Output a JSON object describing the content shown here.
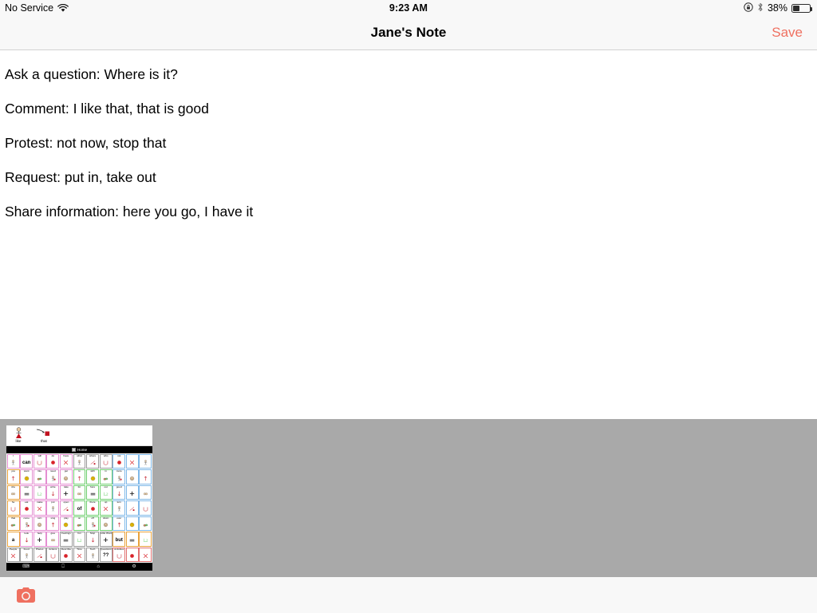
{
  "status_bar": {
    "carrier": "No Service",
    "wifi_icon": "wifi-icon",
    "time": "9:23 AM",
    "rotation_lock_icon": "rotation-lock-icon",
    "bluetooth_icon": "bluetooth-icon",
    "battery_percent": "38%",
    "battery_icon": "battery-icon"
  },
  "nav_bar": {
    "title": "Jane's Note",
    "save_label": "Save",
    "save_color": "#ef7060"
  },
  "note": {
    "lines": [
      "Ask a question: Where is it?",
      "Comment: I like that, that is good",
      "Protest: not now, stop that",
      "Request: put in, take out",
      "Share information: here you go, I have it"
    ]
  },
  "attachment": {
    "background_color": "#a9a9a9",
    "thumbnail": {
      "name": "aac-board-screenshot",
      "sentence_bar": [
        {
          "label": "like",
          "symbol": "person-with-heart"
        },
        {
          "label": "that",
          "symbol": "pointing-hand-at-square"
        }
      ],
      "home_bar_label": "Home",
      "grid_rows": [
        [
          {
            "label": "I",
            "big": "",
            "border": "#e58fd2"
          },
          {
            "label": "",
            "big": "can",
            "border": "#e58fd2"
          },
          {
            "label": "will",
            "big": "",
            "border": "#e58fd2"
          },
          {
            "label": "do",
            "big": "",
            "border": "#e58fd2"
          },
          {
            "label": "have",
            "big": "",
            "border": "#e58fd2"
          },
          {
            "label": "what",
            "big": "",
            "border": "#9a9a9a"
          },
          {
            "label": "where",
            "big": "",
            "border": "#9a9a9a"
          },
          {
            "label": "who",
            "big": "",
            "border": "#9a9a9a"
          },
          {
            "label": "not",
            "big": "",
            "border": "#7fb8e8"
          },
          {
            "label": "",
            "big": "",
            "border": "#7fb8e8"
          },
          {
            "label": "",
            "big": "",
            "border": "#7fb8e8"
          }
        ],
        [
          {
            "label": "you",
            "big": "",
            "border": "#e9a23b"
          },
          {
            "label": "want",
            "big": "",
            "border": "#e58fd2"
          },
          {
            "label": "like",
            "big": "",
            "border": "#e58fd2"
          },
          {
            "label": "need",
            "big": "",
            "border": "#e58fd2"
          },
          {
            "label": "get",
            "big": "",
            "border": "#e58fd2"
          },
          {
            "label": "to",
            "big": "",
            "border": "#6fcf6f"
          },
          {
            "label": "with",
            "big": "",
            "border": "#6fcf6f"
          },
          {
            "label": "in",
            "big": "",
            "border": "#6fcf6f"
          },
          {
            "label": "more",
            "big": "",
            "border": "#7fb8e8"
          },
          {
            "label": "",
            "big": "",
            "border": "#7fb8e8"
          },
          {
            "label": "",
            "big": "",
            "border": "#7fb8e8"
          }
        ],
        [
          {
            "label": "she",
            "big": "",
            "border": "#e9a23b"
          },
          {
            "label": "stop",
            "big": "",
            "border": "#e58fd2"
          },
          {
            "label": "go",
            "big": "",
            "border": "#e58fd2"
          },
          {
            "label": "write",
            "big": "",
            "border": "#e58fd2"
          },
          {
            "label": "take",
            "big": "",
            "border": "#e58fd2"
          },
          {
            "label": "for",
            "big": "",
            "border": "#6fcf6f"
          },
          {
            "label": "here",
            "big": "",
            "border": "#6fcf6f"
          },
          {
            "label": "out",
            "big": "",
            "border": "#6fcf6f"
          },
          {
            "label": "good",
            "big": "",
            "border": "#7fb8e8"
          },
          {
            "label": "",
            "big": "",
            "border": "#7fb8e8"
          },
          {
            "label": "",
            "big": "",
            "border": "#7fb8e8"
          }
        ],
        [
          {
            "label": "he",
            "big": "",
            "border": "#e9a23b"
          },
          {
            "label": "eat",
            "big": "",
            "border": "#e58fd2"
          },
          {
            "label": "make",
            "big": "",
            "border": "#e58fd2"
          },
          {
            "label": "put",
            "big": "",
            "border": "#e58fd2"
          },
          {
            "label": "open",
            "big": "",
            "border": "#e58fd2"
          },
          {
            "label": "",
            "big": "of",
            "border": "#6fcf6f"
          },
          {
            "label": "there",
            "big": "",
            "border": "#6fcf6f"
          },
          {
            "label": "up",
            "big": "",
            "border": "#6fcf6f"
          },
          {
            "label": "turn",
            "big": "",
            "border": "#7fb8e8"
          },
          {
            "label": "",
            "big": "",
            "border": "#7fb8e8"
          },
          {
            "label": "",
            "big": "",
            "border": "#7fb8e8"
          }
        ],
        [
          {
            "label": "that",
            "big": "",
            "border": "#e9a23b"
          },
          {
            "label": "come",
            "big": "",
            "border": "#e58fd2"
          },
          {
            "label": "turn",
            "big": "",
            "border": "#e58fd2"
          },
          {
            "label": "sing",
            "big": "",
            "border": "#e58fd2"
          },
          {
            "label": "play",
            "big": "",
            "border": "#e58fd2"
          },
          {
            "label": "on",
            "big": "",
            "border": "#6fcf6f"
          },
          {
            "label": "off",
            "big": "",
            "border": "#6fcf6f"
          },
          {
            "label": "down",
            "big": "",
            "border": "#6fcf6f"
          },
          {
            "label": "over",
            "big": "",
            "border": "#7fb8e8"
          },
          {
            "label": "",
            "big": "",
            "border": "#7fb8e8"
          },
          {
            "label": "",
            "big": "",
            "border": "#7fb8e8"
          }
        ],
        [
          {
            "label": "",
            "big": "a",
            "border": "#e9a23b"
          },
          {
            "label": "look",
            "big": "",
            "border": "#e58fd2"
          },
          {
            "label": "help",
            "big": "",
            "border": "#e58fd2"
          },
          {
            "label": "give",
            "big": "",
            "border": "#e58fd2"
          },
          {
            "label": "Feelings",
            "big": "",
            "border": "#9a9a9a"
          },
          {
            "label": "fun",
            "big": "",
            "border": "#9a9a9a"
          },
          {
            "label": "Stop",
            "big": "",
            "border": "#9a9a9a"
          },
          {
            "label": "Little Words",
            "big": "",
            "border": "#9a9a9a"
          },
          {
            "label": "",
            "big": "but",
            "border": "#e9a23b"
          },
          {
            "label": "",
            "big": "",
            "border": "#e9a23b"
          },
          {
            "label": "",
            "big": "",
            "border": "#e9a23b"
          }
        ],
        [
          {
            "label": "People",
            "big": "",
            "border": "#9a9a9a"
          },
          {
            "label": "Food",
            "big": "",
            "border": "#9a9a9a"
          },
          {
            "label": "Places",
            "big": "",
            "border": "#9a9a9a"
          },
          {
            "label": "Actions",
            "big": "",
            "border": "#9a9a9a"
          },
          {
            "label": "Describe",
            "big": "",
            "border": "#9a9a9a"
          },
          {
            "label": "Time",
            "big": "",
            "border": "#9a9a9a"
          },
          {
            "label": "Tech",
            "big": "",
            "border": "#9a9a9a"
          },
          {
            "label": "Questions?",
            "big": "??",
            "border": "#9a9a9a"
          },
          {
            "label": "Activities",
            "big": "",
            "border": "#e07070"
          },
          {
            "label": "",
            "big": "",
            "border": "#e07070"
          },
          {
            "label": "",
            "big": "",
            "border": "#e07070"
          }
        ]
      ],
      "bottom_nav": [
        "keyboard-icon",
        "home-icon",
        "gear-icon"
      ]
    }
  },
  "toolbar": {
    "camera_icon": "camera-icon",
    "camera_color": "#ef7060"
  }
}
